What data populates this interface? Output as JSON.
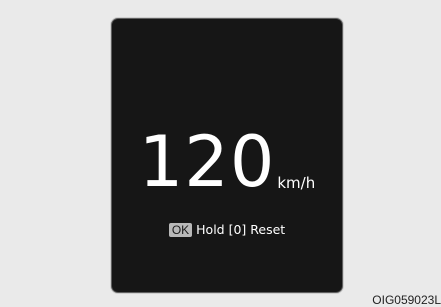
{
  "display": {
    "speed_value": "120",
    "speed_unit": "km/h",
    "ok_key_label": "OK",
    "reset_instruction": "Hold [0] Reset"
  },
  "figure_code": "OIG059023L",
  "colors": {
    "page_background": "#eaeaea",
    "panel_background": "#161616",
    "text": "#ffffff",
    "ok_key_background": "#b8b8b8"
  }
}
